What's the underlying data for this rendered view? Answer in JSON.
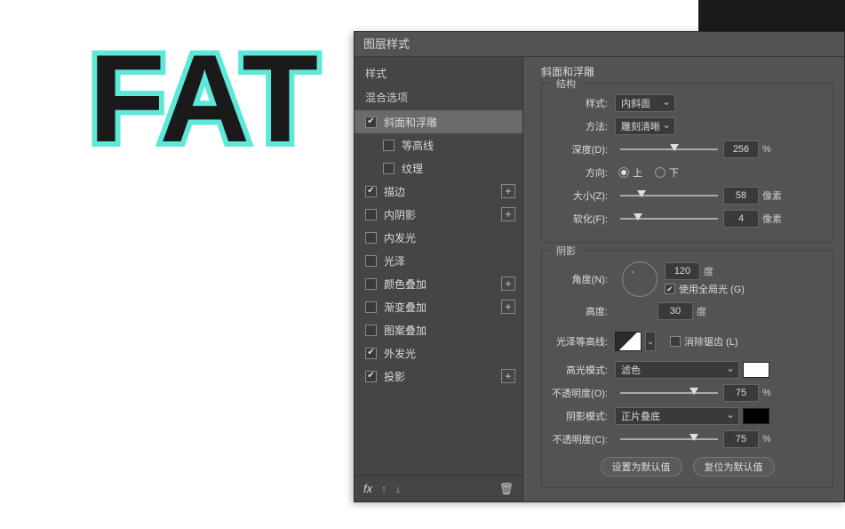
{
  "canvas": {
    "text": "FAT"
  },
  "dialog": {
    "title": "图层样式",
    "styles_header": "样式",
    "blend_options": "混合选项",
    "items": [
      {
        "label": "斜面和浮雕",
        "checked": true,
        "selected": true,
        "plus": false,
        "indent": false
      },
      {
        "label": "等高线",
        "checked": false,
        "selected": false,
        "plus": false,
        "indent": true
      },
      {
        "label": "纹理",
        "checked": false,
        "selected": false,
        "plus": false,
        "indent": true
      },
      {
        "label": "描边",
        "checked": true,
        "selected": false,
        "plus": true,
        "indent": false
      },
      {
        "label": "内阴影",
        "checked": false,
        "selected": false,
        "plus": true,
        "indent": false
      },
      {
        "label": "内发光",
        "checked": false,
        "selected": false,
        "plus": false,
        "indent": false
      },
      {
        "label": "光泽",
        "checked": false,
        "selected": false,
        "plus": false,
        "indent": false
      },
      {
        "label": "颜色叠加",
        "checked": false,
        "selected": false,
        "plus": true,
        "indent": false
      },
      {
        "label": "渐变叠加",
        "checked": false,
        "selected": false,
        "plus": true,
        "indent": false
      },
      {
        "label": "图案叠加",
        "checked": false,
        "selected": false,
        "plus": false,
        "indent": false
      },
      {
        "label": "外发光",
        "checked": true,
        "selected": false,
        "plus": false,
        "indent": false
      },
      {
        "label": "投影",
        "checked": true,
        "selected": false,
        "plus": true,
        "indent": false
      }
    ],
    "footer": {
      "fx": "fx"
    }
  },
  "bevel": {
    "title": "斜面和浮雕",
    "structure_label": "结构",
    "style_label": "样式:",
    "style_value": "内斜面",
    "method_label": "方法:",
    "method_value": "雕刻清晰",
    "depth_label": "深度(D):",
    "depth_value": "256",
    "depth_unit": "%",
    "direction_label": "方向:",
    "up": "上",
    "down": "下",
    "size_label": "大小(Z):",
    "size_value": "58",
    "size_unit": "像素",
    "soften_label": "软化(F):",
    "soften_value": "4",
    "soften_unit": "像素",
    "shading_label": "阴影",
    "angle_label": "角度(N):",
    "angle_value": "120",
    "angle_unit": "度",
    "global_light": "使用全局光 (G)",
    "altitude_label": "高度:",
    "altitude_value": "30",
    "altitude_unit": "度",
    "gloss_label": "光泽等高线:",
    "antialias": "消除锯齿 (L)",
    "highlight_mode_label": "高光模式:",
    "highlight_mode_value": "滤色",
    "opacity_o_label": "不透明度(O):",
    "opacity_o_value": "75",
    "opacity_o_unit": "%",
    "shadow_mode_label": "阴影模式:",
    "shadow_mode_value": "正片叠底",
    "opacity_c_label": "不透明度(C):",
    "opacity_c_value": "75",
    "opacity_c_unit": "%",
    "buttons": {
      "default": "设置为默认值",
      "reset": "复位为默认值"
    }
  }
}
